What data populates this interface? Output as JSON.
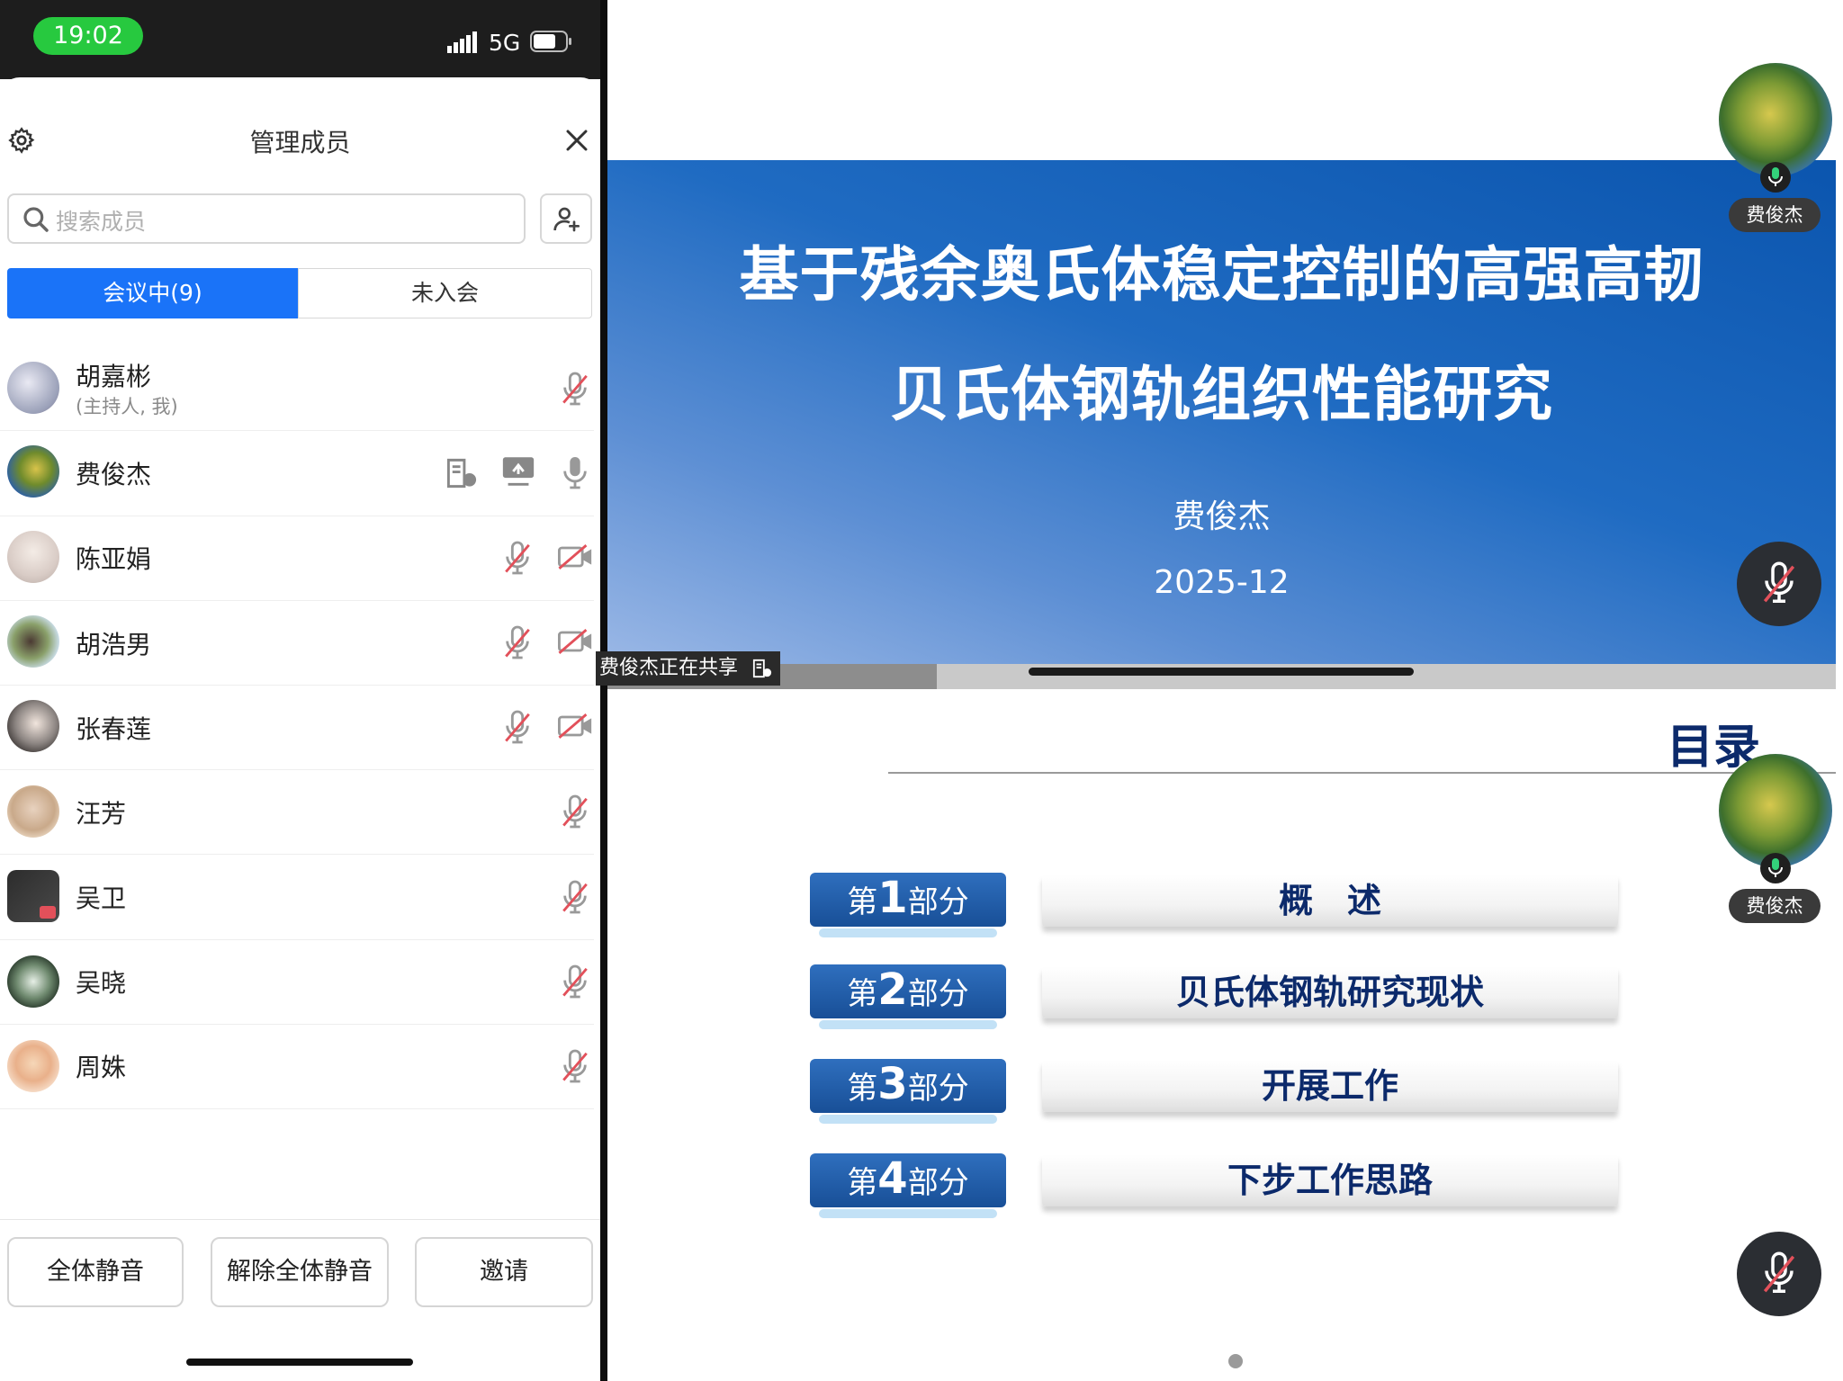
{
  "status": {
    "time": "19:02",
    "network": "5G"
  },
  "panel": {
    "title": "管理成员",
    "search_placeholder": "搜索成员",
    "tabs": [
      {
        "label": "会议中(9)",
        "active": true
      },
      {
        "label": "未入会",
        "active": false
      }
    ],
    "members": [
      {
        "name": "胡嘉彬",
        "role": "(主持人, 我)",
        "mic": "muted"
      },
      {
        "name": "费俊杰",
        "role": "",
        "mic": "on",
        "sharing": true
      },
      {
        "name": "陈亚娟",
        "role": "",
        "mic": "muted",
        "camera": "off"
      },
      {
        "name": "胡浩男",
        "role": "",
        "mic": "muted",
        "camera": "off"
      },
      {
        "name": "张春莲",
        "role": "",
        "mic": "muted",
        "camera": "off"
      },
      {
        "name": "汪芳",
        "role": "",
        "mic": "muted"
      },
      {
        "name": "吴卫",
        "role": "",
        "mic": "muted"
      },
      {
        "name": "吴晓",
        "role": "",
        "mic": "muted"
      },
      {
        "name": "周姝",
        "role": "",
        "mic": "muted"
      }
    ],
    "buttons": {
      "mute_all": "全体静音",
      "unmute_all": "解除全体静音",
      "invite": "邀请"
    }
  },
  "slide1": {
    "title_line1": "基于残余奥氏体稳定控制的高强高韧",
    "title_line2": "贝氏体钢轨组织性能研究",
    "author": "费俊杰",
    "date": "2025-12"
  },
  "sharing_label": "费俊杰正在共享",
  "slide2": {
    "heading": "目录",
    "parts": [
      {
        "prefix": "第",
        "num": "1",
        "suffix": "部分",
        "title": "概　述"
      },
      {
        "prefix": "第",
        "num": "2",
        "suffix": "部分",
        "title": "贝氏体钢轨研究现状"
      },
      {
        "prefix": "第",
        "num": "3",
        "suffix": "部分",
        "title": "开展工作"
      },
      {
        "prefix": "第",
        "num": "4",
        "suffix": "部分",
        "title": "下步工作思路"
      }
    ]
  },
  "speaker_tile": {
    "name": "费俊杰"
  },
  "colors": {
    "accent": "#1a73f8",
    "status_green": "#27c93f",
    "slide_blue": "#0b55ae",
    "toc_navy": "#0c2a6b"
  }
}
